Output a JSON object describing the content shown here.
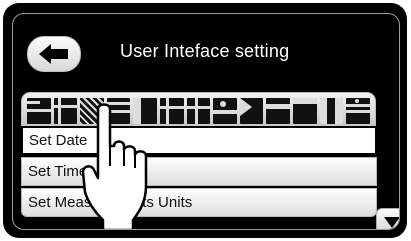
{
  "header": {
    "title": "User Inteface setting",
    "back_icon": "arrow-left-icon"
  },
  "flags": {
    "count": 13,
    "icon": "language-flag-icon"
  },
  "menu": {
    "items": [
      {
        "label": "Set Date",
        "selected": true
      },
      {
        "label": "Set Time",
        "selected": false
      },
      {
        "label": "Set Measurements Units",
        "selected": false
      }
    ]
  },
  "scroll": {
    "down_icon": "triangle-down-icon"
  },
  "overlay": {
    "icon": "pointing-hand-icon"
  }
}
